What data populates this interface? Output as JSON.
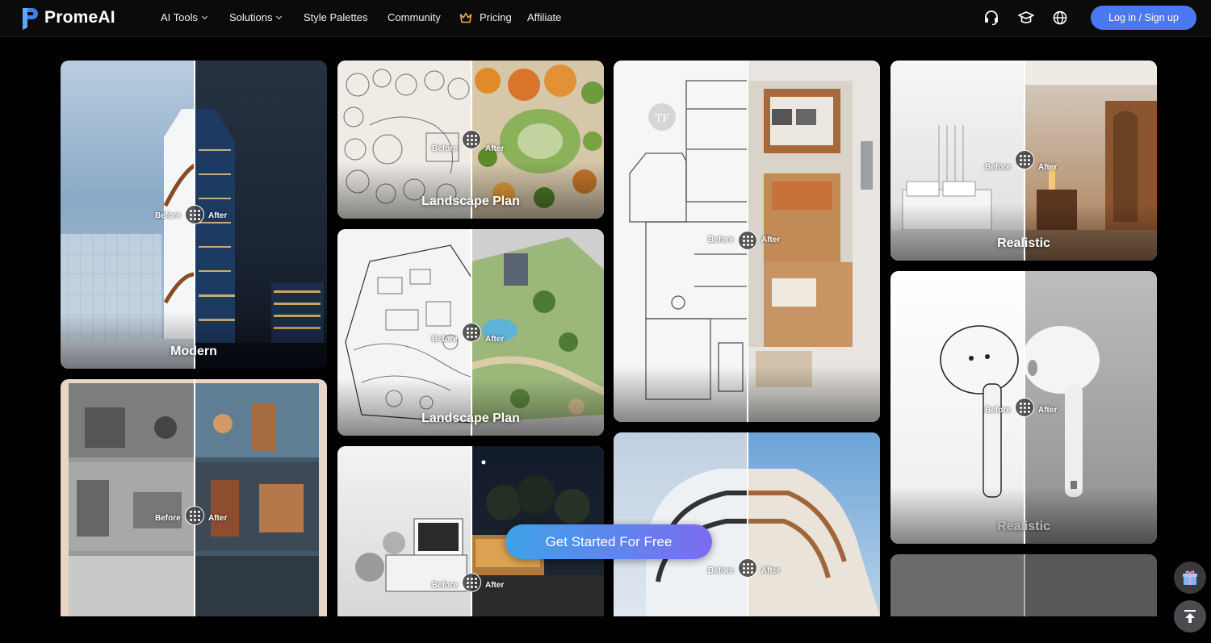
{
  "brand": {
    "name": "PromeAI"
  },
  "nav": {
    "items": [
      {
        "label": "AI Tools",
        "dropdown": true
      },
      {
        "label": "Solutions",
        "dropdown": true
      },
      {
        "label": "Style Palettes",
        "dropdown": false
      },
      {
        "label": "Community",
        "dropdown": false
      },
      {
        "label": "Pricing",
        "dropdown": false,
        "icon": "crown-icon"
      },
      {
        "label": "Affiliate",
        "dropdown": false
      }
    ],
    "icons": [
      "headset-icon",
      "graduation-cap-icon",
      "globe-icon"
    ],
    "login_label": "Log in / Sign up"
  },
  "compare": {
    "before": "Before",
    "after": "After"
  },
  "cards": {
    "modern": {
      "caption": "Modern"
    },
    "landscape1": {
      "caption": "Landscape Plan"
    },
    "landscape2": {
      "caption": "Landscape Plan"
    },
    "floorplan": {
      "caption": ""
    },
    "realistic1": {
      "caption": "Realistic"
    },
    "realistic2": {
      "caption": "Realistic"
    },
    "storyboard": {
      "caption": ""
    },
    "house": {
      "caption": ""
    },
    "curved": {
      "caption": ""
    },
    "sketch": {
      "caption": ""
    }
  },
  "cta": {
    "label": "Get Started For Free"
  },
  "floating": {
    "gift": "gift-icon",
    "top": "back-to-top-icon"
  },
  "colors": {
    "accent": "#4a78f0",
    "cta_start": "#3fa2e6",
    "cta_end": "#7b6cf0",
    "background": "#000000"
  }
}
